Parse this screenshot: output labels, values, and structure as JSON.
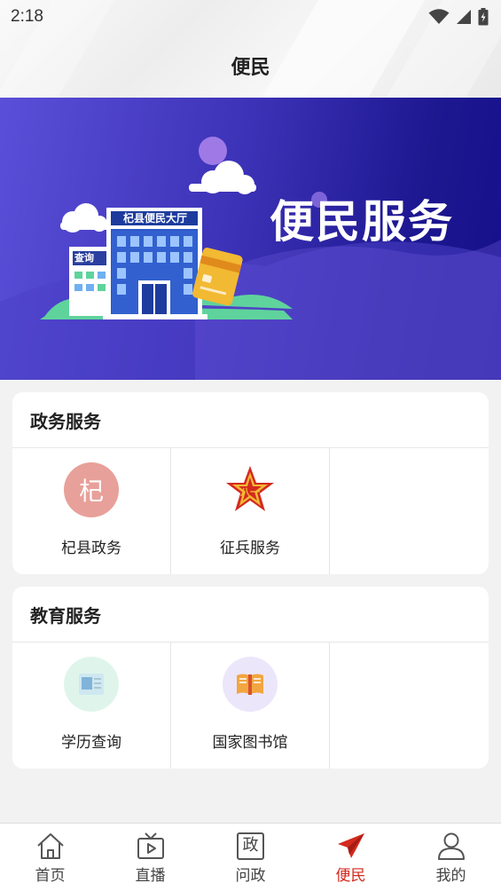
{
  "status_bar": {
    "time": "2:18"
  },
  "header": {
    "title": "便民"
  },
  "banner": {
    "building_sign": "杞县便民大厅",
    "kiosk_sign": "查询",
    "headline": "便民服务"
  },
  "sections": [
    {
      "title": "政务服务",
      "items": [
        {
          "label": "杞县政务",
          "icon": "qi-county-seal-icon",
          "icon_glyph": "杞",
          "color": "#e8a09a"
        },
        {
          "label": "征兵服务",
          "icon": "army-star-icon",
          "color": "#d42a1e"
        }
      ]
    },
    {
      "title": "教育服务",
      "items": [
        {
          "label": "学历查询",
          "icon": "certificate-icon",
          "color": "#dff5ec"
        },
        {
          "label": "国家图书馆",
          "icon": "open-book-icon",
          "color": "#ece6fb"
        }
      ]
    }
  ],
  "tabbar": {
    "items": [
      {
        "label": "首页",
        "icon": "home-icon"
      },
      {
        "label": "直播",
        "icon": "tv-play-icon"
      },
      {
        "label": "问政",
        "icon": "politics-box-icon",
        "icon_glyph": "政"
      },
      {
        "label": "便民",
        "icon": "paper-plane-icon",
        "active": true
      },
      {
        "label": "我的",
        "icon": "user-icon"
      }
    ],
    "active_color": "#d42a1e"
  }
}
